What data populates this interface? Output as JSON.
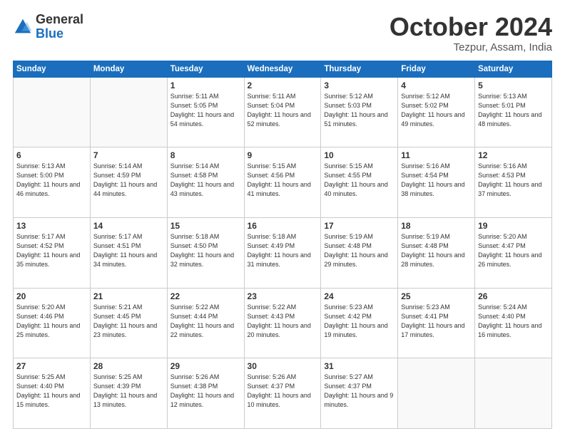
{
  "header": {
    "logo_general": "General",
    "logo_blue": "Blue",
    "month_title": "October 2024",
    "location": "Tezpur, Assam, India"
  },
  "weekdays": [
    "Sunday",
    "Monday",
    "Tuesday",
    "Wednesday",
    "Thursday",
    "Friday",
    "Saturday"
  ],
  "weeks": [
    [
      {
        "day": "",
        "info": ""
      },
      {
        "day": "",
        "info": ""
      },
      {
        "day": "1",
        "info": "Sunrise: 5:11 AM\nSunset: 5:05 PM\nDaylight: 11 hours and 54 minutes."
      },
      {
        "day": "2",
        "info": "Sunrise: 5:11 AM\nSunset: 5:04 PM\nDaylight: 11 hours and 52 minutes."
      },
      {
        "day": "3",
        "info": "Sunrise: 5:12 AM\nSunset: 5:03 PM\nDaylight: 11 hours and 51 minutes."
      },
      {
        "day": "4",
        "info": "Sunrise: 5:12 AM\nSunset: 5:02 PM\nDaylight: 11 hours and 49 minutes."
      },
      {
        "day": "5",
        "info": "Sunrise: 5:13 AM\nSunset: 5:01 PM\nDaylight: 11 hours and 48 minutes."
      }
    ],
    [
      {
        "day": "6",
        "info": "Sunrise: 5:13 AM\nSunset: 5:00 PM\nDaylight: 11 hours and 46 minutes."
      },
      {
        "day": "7",
        "info": "Sunrise: 5:14 AM\nSunset: 4:59 PM\nDaylight: 11 hours and 44 minutes."
      },
      {
        "day": "8",
        "info": "Sunrise: 5:14 AM\nSunset: 4:58 PM\nDaylight: 11 hours and 43 minutes."
      },
      {
        "day": "9",
        "info": "Sunrise: 5:15 AM\nSunset: 4:56 PM\nDaylight: 11 hours and 41 minutes."
      },
      {
        "day": "10",
        "info": "Sunrise: 5:15 AM\nSunset: 4:55 PM\nDaylight: 11 hours and 40 minutes."
      },
      {
        "day": "11",
        "info": "Sunrise: 5:16 AM\nSunset: 4:54 PM\nDaylight: 11 hours and 38 minutes."
      },
      {
        "day": "12",
        "info": "Sunrise: 5:16 AM\nSunset: 4:53 PM\nDaylight: 11 hours and 37 minutes."
      }
    ],
    [
      {
        "day": "13",
        "info": "Sunrise: 5:17 AM\nSunset: 4:52 PM\nDaylight: 11 hours and 35 minutes."
      },
      {
        "day": "14",
        "info": "Sunrise: 5:17 AM\nSunset: 4:51 PM\nDaylight: 11 hours and 34 minutes."
      },
      {
        "day": "15",
        "info": "Sunrise: 5:18 AM\nSunset: 4:50 PM\nDaylight: 11 hours and 32 minutes."
      },
      {
        "day": "16",
        "info": "Sunrise: 5:18 AM\nSunset: 4:49 PM\nDaylight: 11 hours and 31 minutes."
      },
      {
        "day": "17",
        "info": "Sunrise: 5:19 AM\nSunset: 4:48 PM\nDaylight: 11 hours and 29 minutes."
      },
      {
        "day": "18",
        "info": "Sunrise: 5:19 AM\nSunset: 4:48 PM\nDaylight: 11 hours and 28 minutes."
      },
      {
        "day": "19",
        "info": "Sunrise: 5:20 AM\nSunset: 4:47 PM\nDaylight: 11 hours and 26 minutes."
      }
    ],
    [
      {
        "day": "20",
        "info": "Sunrise: 5:20 AM\nSunset: 4:46 PM\nDaylight: 11 hours and 25 minutes."
      },
      {
        "day": "21",
        "info": "Sunrise: 5:21 AM\nSunset: 4:45 PM\nDaylight: 11 hours and 23 minutes."
      },
      {
        "day": "22",
        "info": "Sunrise: 5:22 AM\nSunset: 4:44 PM\nDaylight: 11 hours and 22 minutes."
      },
      {
        "day": "23",
        "info": "Sunrise: 5:22 AM\nSunset: 4:43 PM\nDaylight: 11 hours and 20 minutes."
      },
      {
        "day": "24",
        "info": "Sunrise: 5:23 AM\nSunset: 4:42 PM\nDaylight: 11 hours and 19 minutes."
      },
      {
        "day": "25",
        "info": "Sunrise: 5:23 AM\nSunset: 4:41 PM\nDaylight: 11 hours and 17 minutes."
      },
      {
        "day": "26",
        "info": "Sunrise: 5:24 AM\nSunset: 4:40 PM\nDaylight: 11 hours and 16 minutes."
      }
    ],
    [
      {
        "day": "27",
        "info": "Sunrise: 5:25 AM\nSunset: 4:40 PM\nDaylight: 11 hours and 15 minutes."
      },
      {
        "day": "28",
        "info": "Sunrise: 5:25 AM\nSunset: 4:39 PM\nDaylight: 11 hours and 13 minutes."
      },
      {
        "day": "29",
        "info": "Sunrise: 5:26 AM\nSunset: 4:38 PM\nDaylight: 11 hours and 12 minutes."
      },
      {
        "day": "30",
        "info": "Sunrise: 5:26 AM\nSunset: 4:37 PM\nDaylight: 11 hours and 10 minutes."
      },
      {
        "day": "31",
        "info": "Sunrise: 5:27 AM\nSunset: 4:37 PM\nDaylight: 11 hours and 9 minutes."
      },
      {
        "day": "",
        "info": ""
      },
      {
        "day": "",
        "info": ""
      }
    ]
  ]
}
